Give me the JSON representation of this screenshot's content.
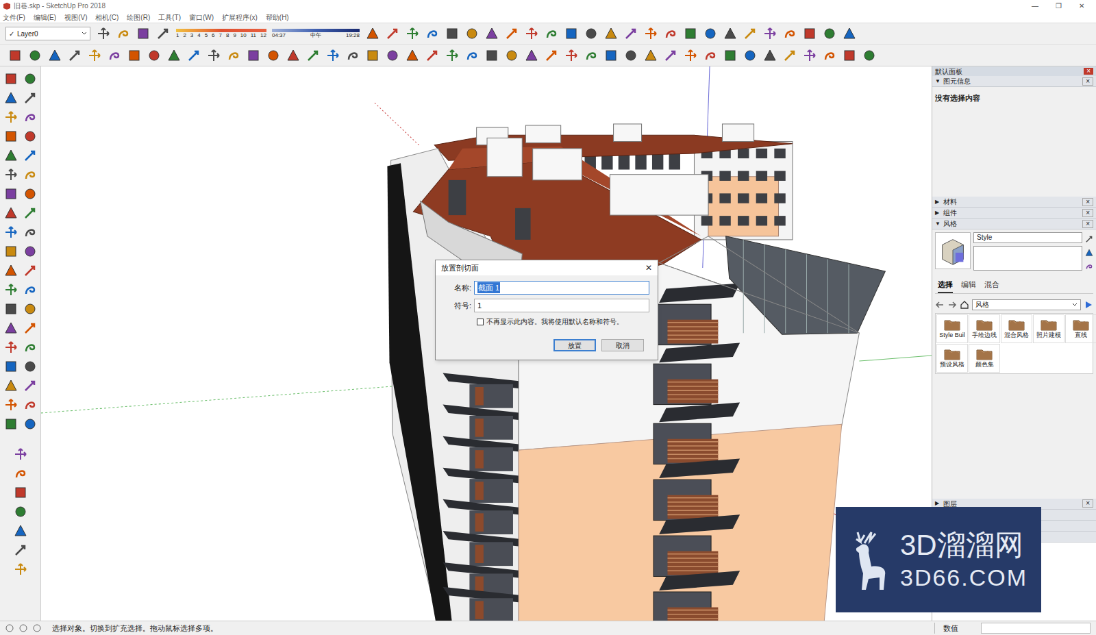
{
  "window": {
    "title": "旧巷.skp - SketchUp Pro 2018",
    "controls": [
      "—",
      "❐",
      "✕"
    ]
  },
  "menu": [
    "文件(F)",
    "编辑(E)",
    "视图(V)",
    "相机(C)",
    "绘图(R)",
    "工具(T)",
    "窗口(W)",
    "扩展程序(x)",
    "帮助(H)"
  ],
  "toolbar": {
    "layer": {
      "check": "✓",
      "value": "Layer0"
    },
    "shadow": {
      "months": [
        "1",
        "2",
        "3",
        "4",
        "5",
        "6",
        "7",
        "8",
        "9",
        "10",
        "11",
        "12"
      ],
      "time_start": "04:37",
      "time_mid": "中午",
      "time_end": "19:28"
    }
  },
  "dialog": {
    "title": "放置剖切面",
    "close": "✕",
    "fields": [
      {
        "label": "名称:",
        "value": "截面 1",
        "selected": true
      },
      {
        "label": "符号:",
        "value": "1",
        "selected": false
      }
    ],
    "checkbox": {
      "label": "不再显示此内容。我将使用默认名称和符号。",
      "checked": false
    },
    "buttons": [
      {
        "label": "放置",
        "default": true
      },
      {
        "label": "取消",
        "default": false
      }
    ]
  },
  "tray": {
    "title": "默认面板",
    "close": "×",
    "expanded_glyph": "▼",
    "collapsed_glyph": "▶",
    "sections": [
      {
        "kind": "entity",
        "label": "图元信息",
        "expanded": true,
        "text": "没有选择内容"
      },
      {
        "kind": "collapsed",
        "label": "材料",
        "expanded": false
      },
      {
        "kind": "collapsed",
        "label": "组件",
        "expanded": false
      },
      {
        "kind": "style",
        "label": "风格",
        "expanded": true,
        "name": "Style",
        "tabs": [
          {
            "label": "选择",
            "selected": true
          },
          {
            "label": "编辑",
            "selected": false
          },
          {
            "label": "混合",
            "selected": false
          }
        ],
        "library": "风格",
        "thumbnails": [
          "Style Buil",
          "手绘边线",
          "混合风格",
          "照片建模",
          "直线",
          "预设风格",
          "颜色集"
        ]
      },
      {
        "kind": "collapsed",
        "label": "图层",
        "expanded": false
      }
    ]
  },
  "status_bar": {
    "message": "选择对象。切换到扩充选择。拖动鼠标选择多项。",
    "measurements_label": "数值"
  },
  "watermark": {
    "brand": "3D溜溜网",
    "url": "3D66.COM"
  }
}
